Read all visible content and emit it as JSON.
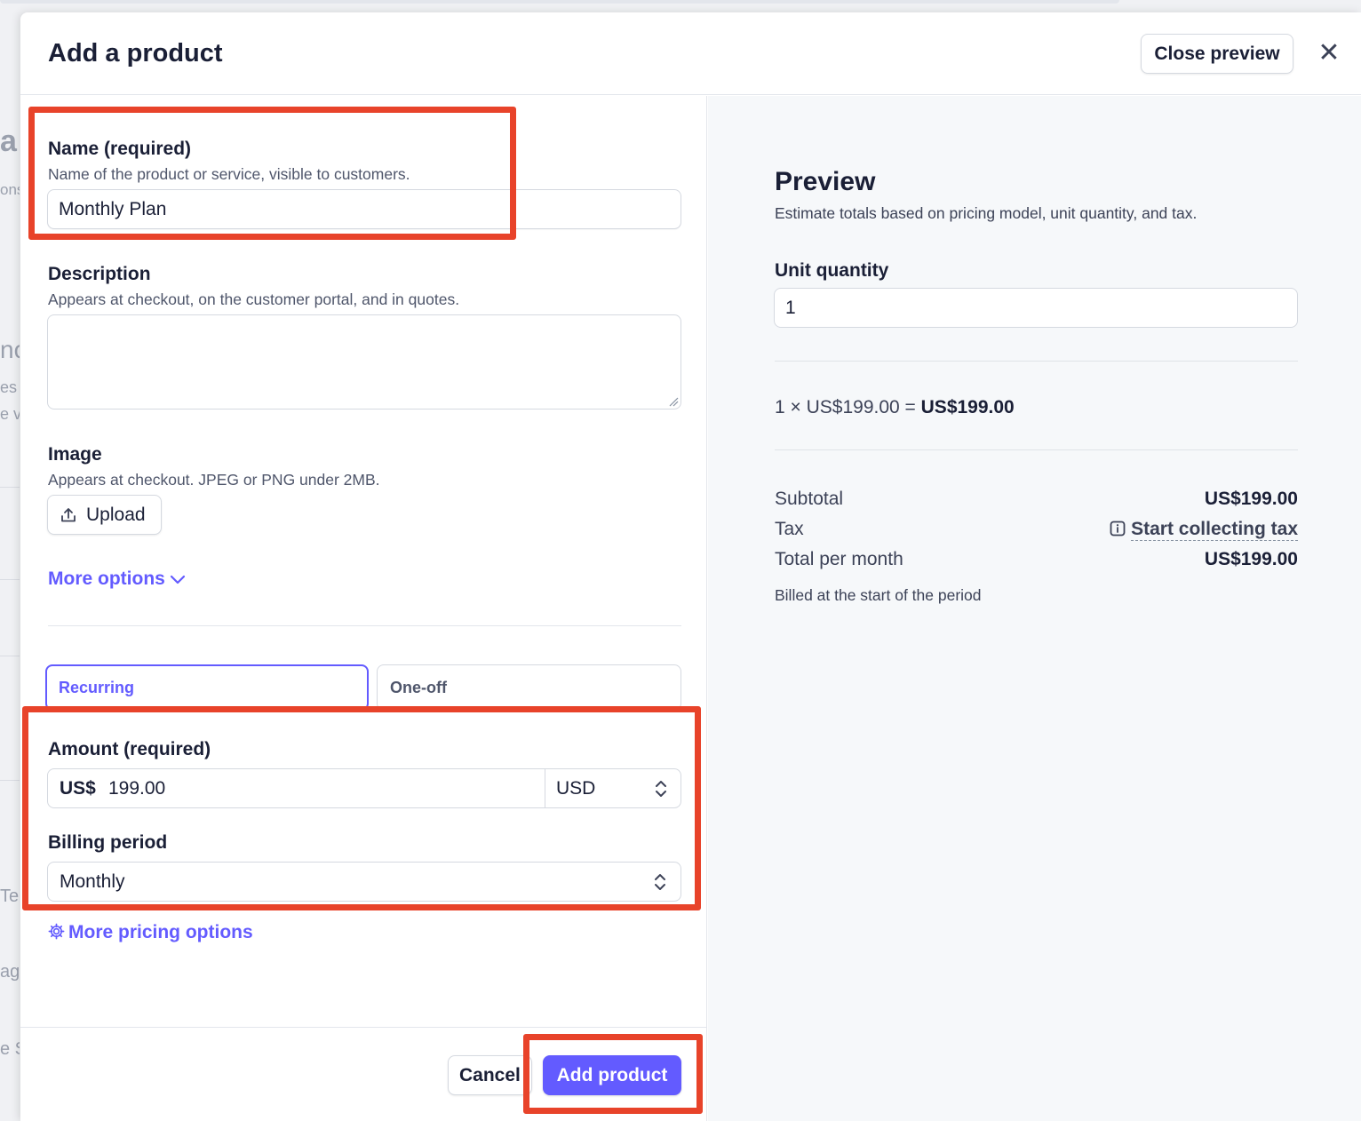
{
  "drawer": {
    "title": "Add a product",
    "close_preview_label": "Close preview",
    "close_icon_glyph": "✕"
  },
  "form": {
    "name": {
      "label": "Name (required)",
      "hint": "Name of the product or service, visible to customers.",
      "value": "Monthly Plan"
    },
    "description": {
      "label": "Description",
      "hint": "Appears at checkout, on the customer portal, and in quotes.",
      "value": ""
    },
    "image": {
      "label": "Image",
      "hint": "Appears at checkout. JPEG or PNG under 2MB.",
      "upload_label": "Upload",
      "upload_icon": "upload-icon"
    },
    "more_options_label": "More options",
    "price_type": {
      "options": [
        "Recurring",
        "One-off"
      ],
      "selected": "Recurring"
    },
    "amount": {
      "label": "Amount (required)",
      "prefix": "US$",
      "value": "199.00",
      "currency": "USD"
    },
    "billing_period": {
      "label": "Billing period",
      "value": "Monthly"
    },
    "more_pricing_label": "More pricing options",
    "more_pricing_icon": "gear-icon"
  },
  "footer": {
    "cancel_label": "Cancel",
    "add_label": "Add product"
  },
  "preview": {
    "title": "Preview",
    "subtitle": "Estimate totals based on pricing model, unit quantity, and tax.",
    "unit_quantity_label": "Unit quantity",
    "unit_quantity_value": "1",
    "calc_prefix": "1 × US$199.00 = ",
    "calc_total": "US$199.00",
    "subtotal_label": "Subtotal",
    "subtotal_value": "US$199.00",
    "tax_label": "Tax",
    "tax_link": "Start collecting tax",
    "total_label": "Total per month",
    "total_value": "US$199.00",
    "billed_note": "Billed at the start of the period"
  },
  "colors": {
    "accent": "#635bff",
    "annotation": "#e8432a",
    "text": "#1a1f36",
    "preview_bg": "#f6f8fa"
  }
}
